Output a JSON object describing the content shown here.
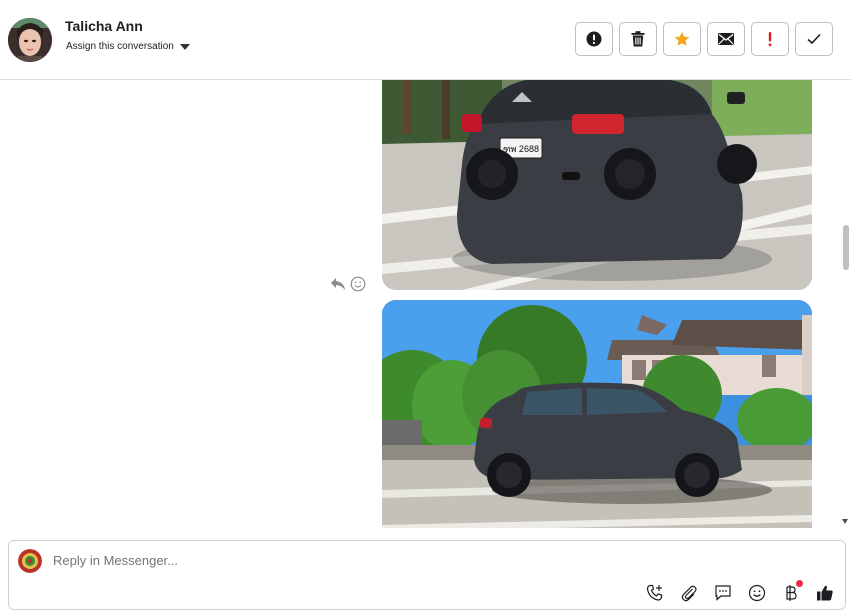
{
  "header": {
    "contact_name": "Talicha Ann",
    "assign_label": "Assign this conversation",
    "actions": [
      {
        "name": "report-spam-button",
        "icon": "exclamation-circle-icon"
      },
      {
        "name": "delete-button",
        "icon": "trash-icon"
      },
      {
        "name": "star-button",
        "icon": "star-icon"
      },
      {
        "name": "mark-unread-button",
        "icon": "envelope-icon"
      },
      {
        "name": "mark-important-button",
        "icon": "exclamation-icon"
      },
      {
        "name": "mark-done-button",
        "icon": "checkmark-icon"
      }
    ]
  },
  "messages": {
    "photo1_plate": "ฑพ 2688",
    "photo_alt_1": "",
    "photo_alt_2": ""
  },
  "composer": {
    "placeholder": "Reply in Messenger..."
  },
  "colors": {
    "star": "#f5a623",
    "important": "#e02020",
    "notif_dot": "#f02849",
    "border": "#dadde1"
  }
}
